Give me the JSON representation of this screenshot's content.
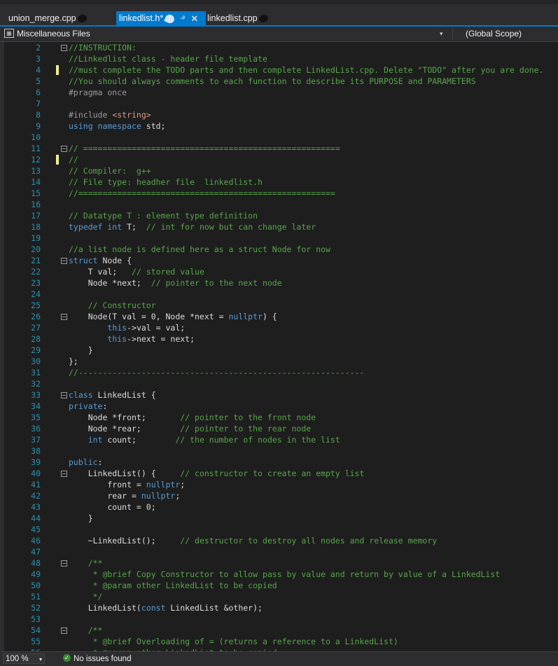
{
  "tabs": [
    {
      "label": "union_merge.cpp",
      "active": false
    },
    {
      "label": "linkedlist.h*",
      "active": true,
      "pin_icon": "pin-icon",
      "close_icon": "close-icon"
    },
    {
      "label": "linkedlist.cpp",
      "active": false
    }
  ],
  "navbar": {
    "project": "Miscellaneous Files",
    "scope": "(Global Scope)",
    "project_icon": "project-icon",
    "dropdown_icon": "chevron-down-icon"
  },
  "status": {
    "zoom": "100 %",
    "issues": "No issues found",
    "issues_icon": "check-circle-icon"
  },
  "colors": {
    "accent": "#007acc",
    "comment": "#57a64a",
    "keyword": "#569cd6",
    "string": "#d69d85",
    "line_number": "#2b91af",
    "changed_marker": "#efef8f"
  },
  "lines": [
    {
      "n": "2",
      "fold": "-",
      "mark": false,
      "parts": [
        {
          "t": "//INSTRUCTION:",
          "c": "comment"
        }
      ]
    },
    {
      "n": "3",
      "mark": false,
      "parts": [
        {
          "t": "//Linkedlist class - header file template",
          "c": "comment"
        }
      ]
    },
    {
      "n": "4",
      "mark": true,
      "parts": [
        {
          "t": "//must complete the TODO parts and then complete LinkedList.cpp. Delete \"TODO\" after you are done.",
          "c": "comment"
        }
      ]
    },
    {
      "n": "5",
      "mark": false,
      "parts": [
        {
          "t": "//You should always comments to each function to describe its PURPOSE and PARAMETERS",
          "c": "comment"
        }
      ]
    },
    {
      "n": "6",
      "mark": false,
      "parts": [
        {
          "t": "#pragma once",
          "c": "pre"
        }
      ]
    },
    {
      "n": "7",
      "mark": false,
      "parts": []
    },
    {
      "n": "8",
      "mark": false,
      "parts": [
        {
          "t": "#include ",
          "c": "pre"
        },
        {
          "t": "<string>",
          "c": "str"
        }
      ]
    },
    {
      "n": "9",
      "mark": false,
      "parts": [
        {
          "t": "using namespace ",
          "c": "kw"
        },
        {
          "t": "std;",
          "c": "plain"
        }
      ]
    },
    {
      "n": "10",
      "mark": false,
      "parts": []
    },
    {
      "n": "11",
      "fold": "-",
      "mark": false,
      "parts": [
        {
          "t": "// =====================================================",
          "c": "comment"
        }
      ]
    },
    {
      "n": "12",
      "mark": true,
      "parts": [
        {
          "t": "//",
          "c": "comment"
        }
      ]
    },
    {
      "n": "13",
      "mark": false,
      "parts": [
        {
          "t": "// Compiler:  g++",
          "c": "comment"
        }
      ]
    },
    {
      "n": "14",
      "mark": false,
      "parts": [
        {
          "t": "// File type: headher file  linkedlist.h",
          "c": "comment"
        }
      ]
    },
    {
      "n": "15",
      "mark": false,
      "parts": [
        {
          "t": "//=====================================================",
          "c": "comment"
        }
      ]
    },
    {
      "n": "16",
      "mark": false,
      "parts": []
    },
    {
      "n": "17",
      "mark": false,
      "parts": [
        {
          "t": "// Datatype T : element type definition",
          "c": "comment"
        }
      ]
    },
    {
      "n": "18",
      "mark": false,
      "parts": [
        {
          "t": "typedef int ",
          "c": "kw"
        },
        {
          "t": "T;  ",
          "c": "plain"
        },
        {
          "t": "// int for now but can change later",
          "c": "comment"
        }
      ]
    },
    {
      "n": "19",
      "mark": false,
      "parts": []
    },
    {
      "n": "20",
      "mark": false,
      "parts": [
        {
          "t": "//a list node is defined here as a struct Node for now",
          "c": "comment"
        }
      ]
    },
    {
      "n": "21",
      "fold": "-",
      "mark": false,
      "parts": [
        {
          "t": "struct ",
          "c": "kw"
        },
        {
          "t": "Node {",
          "c": "plain"
        }
      ]
    },
    {
      "n": "22",
      "mark": false,
      "parts": [
        {
          "t": "    T val;   ",
          "c": "plain"
        },
        {
          "t": "// stored value",
          "c": "comment"
        }
      ]
    },
    {
      "n": "23",
      "mark": false,
      "parts": [
        {
          "t": "    Node *next;  ",
          "c": "plain"
        },
        {
          "t": "// pointer to the next node",
          "c": "comment"
        }
      ]
    },
    {
      "n": "24",
      "mark": false,
      "parts": []
    },
    {
      "n": "25",
      "mark": false,
      "parts": [
        {
          "t": "    // Constructor",
          "c": "comment"
        }
      ]
    },
    {
      "n": "26",
      "fold": "-",
      "mark": false,
      "parts": [
        {
          "t": "    Node(T val = 0, Node *next = ",
          "c": "plain"
        },
        {
          "t": "nullptr",
          "c": "kw"
        },
        {
          "t": ") {",
          "c": "plain"
        }
      ]
    },
    {
      "n": "27",
      "mark": false,
      "parts": [
        {
          "t": "        ",
          "c": "plain"
        },
        {
          "t": "this",
          "c": "kw"
        },
        {
          "t": "->val = val;",
          "c": "plain"
        }
      ]
    },
    {
      "n": "28",
      "mark": false,
      "parts": [
        {
          "t": "        ",
          "c": "plain"
        },
        {
          "t": "this",
          "c": "kw"
        },
        {
          "t": "->next = next;",
          "c": "plain"
        }
      ]
    },
    {
      "n": "29",
      "mark": false,
      "parts": [
        {
          "t": "    }",
          "c": "plain"
        }
      ]
    },
    {
      "n": "30",
      "mark": false,
      "parts": [
        {
          "t": "};",
          "c": "plain"
        }
      ]
    },
    {
      "n": "31",
      "mark": false,
      "parts": [
        {
          "t": "//-----------------------------------------------------------",
          "c": "comment"
        }
      ]
    },
    {
      "n": "32",
      "mark": false,
      "parts": []
    },
    {
      "n": "33",
      "fold": "-",
      "mark": false,
      "parts": [
        {
          "t": "class ",
          "c": "kw"
        },
        {
          "t": "LinkedList {",
          "c": "plain"
        }
      ]
    },
    {
      "n": "34",
      "mark": false,
      "parts": [
        {
          "t": "private",
          "c": "kw"
        },
        {
          "t": ":",
          "c": "plain"
        }
      ]
    },
    {
      "n": "35",
      "mark": false,
      "parts": [
        {
          "t": "    Node *front;       ",
          "c": "plain"
        },
        {
          "t": "// pointer to the front node",
          "c": "comment"
        }
      ]
    },
    {
      "n": "36",
      "mark": false,
      "parts": [
        {
          "t": "    Node *rear;        ",
          "c": "plain"
        },
        {
          "t": "// pointer to the rear node",
          "c": "comment"
        }
      ]
    },
    {
      "n": "37",
      "mark": false,
      "parts": [
        {
          "t": "    ",
          "c": "plain"
        },
        {
          "t": "int ",
          "c": "kw"
        },
        {
          "t": "count;        ",
          "c": "plain"
        },
        {
          "t": "// the number of nodes in the list",
          "c": "comment"
        }
      ]
    },
    {
      "n": "38",
      "mark": false,
      "parts": []
    },
    {
      "n": "39",
      "mark": false,
      "parts": [
        {
          "t": "public",
          "c": "kw"
        },
        {
          "t": ":",
          "c": "plain"
        }
      ]
    },
    {
      "n": "40",
      "fold": "-",
      "mark": false,
      "parts": [
        {
          "t": "    LinkedList() {     ",
          "c": "plain"
        },
        {
          "t": "// constructor to create an empty list",
          "c": "comment"
        }
      ]
    },
    {
      "n": "41",
      "mark": false,
      "parts": [
        {
          "t": "        front = ",
          "c": "plain"
        },
        {
          "t": "nullptr",
          "c": "kw"
        },
        {
          "t": ";",
          "c": "plain"
        }
      ]
    },
    {
      "n": "42",
      "mark": false,
      "parts": [
        {
          "t": "        rear = ",
          "c": "plain"
        },
        {
          "t": "nullptr",
          "c": "kw"
        },
        {
          "t": ";",
          "c": "plain"
        }
      ]
    },
    {
      "n": "43",
      "mark": false,
      "parts": [
        {
          "t": "        count = 0;",
          "c": "plain"
        }
      ]
    },
    {
      "n": "44",
      "mark": false,
      "parts": [
        {
          "t": "    }",
          "c": "plain"
        }
      ]
    },
    {
      "n": "45",
      "mark": false,
      "parts": []
    },
    {
      "n": "46",
      "mark": false,
      "parts": [
        {
          "t": "    ~LinkedList();     ",
          "c": "plain"
        },
        {
          "t": "// destructor to destroy all nodes and release memory",
          "c": "comment"
        }
      ]
    },
    {
      "n": "47",
      "mark": false,
      "parts": []
    },
    {
      "n": "48",
      "fold": "-",
      "mark": false,
      "parts": [
        {
          "t": "    /**",
          "c": "comment"
        }
      ]
    },
    {
      "n": "49",
      "mark": false,
      "parts": [
        {
          "t": "     * @brief Copy Constructor to allow pass by value and return by value of a LinkedList",
          "c": "comment"
        }
      ]
    },
    {
      "n": "50",
      "mark": false,
      "parts": [
        {
          "t": "     * @param other LinkedList to be copied",
          "c": "comment"
        }
      ]
    },
    {
      "n": "51",
      "mark": false,
      "parts": [
        {
          "t": "     */",
          "c": "comment"
        }
      ]
    },
    {
      "n": "52",
      "mark": false,
      "parts": [
        {
          "t": "    LinkedList(",
          "c": "plain"
        },
        {
          "t": "const ",
          "c": "kw"
        },
        {
          "t": "LinkedList &other);",
          "c": "plain"
        }
      ]
    },
    {
      "n": "53",
      "mark": false,
      "parts": []
    },
    {
      "n": "54",
      "fold": "-",
      "mark": false,
      "parts": [
        {
          "t": "    /**",
          "c": "comment"
        }
      ]
    },
    {
      "n": "55",
      "mark": false,
      "parts": [
        {
          "t": "     * @brief Overloading of = (returns a reference to a LinkedList)",
          "c": "comment"
        }
      ]
    },
    {
      "n": "56",
      "mark": false,
      "parts": [
        {
          "t": "     * @param other LinkedList to be copied",
          "c": "comment"
        }
      ]
    }
  ]
}
